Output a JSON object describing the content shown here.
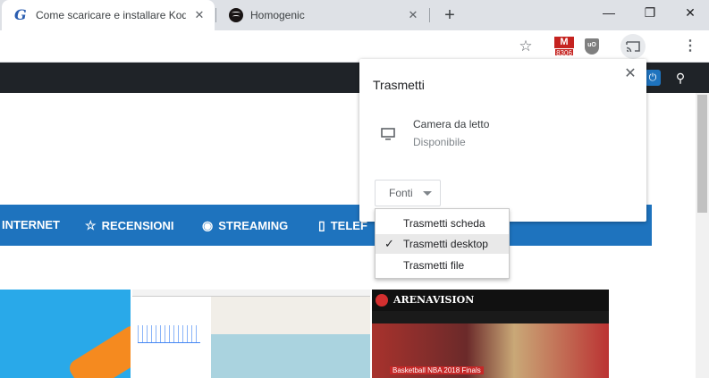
{
  "tabs": [
    {
      "title": "Come scaricare e installare Kodi su",
      "favicon": "g-italic-icon",
      "active": true
    },
    {
      "title": "Homogenic",
      "favicon": "spotify-icon",
      "active": false
    }
  ],
  "new_tab": "+",
  "window": {
    "minimize": "—",
    "restore": "❐",
    "close": "✕"
  },
  "toolbar": {
    "bookmark": "☆",
    "ext_mega_label": "M",
    "ext_mega_badge": "8306",
    "ext_ublock": "uO",
    "menu": "⋮"
  },
  "site": {
    "nav": [
      {
        "label": "INTERNET",
        "icon": ""
      },
      {
        "label": "RECENSIONI",
        "icon": "☆"
      },
      {
        "label": "STREAMING",
        "icon": "◉"
      },
      {
        "label": "TELEF",
        "icon": "▯"
      }
    ],
    "arenavision_logo": "ARENAVISION",
    "thumb_caption": "Basketball NBA 2018 Finals"
  },
  "cast": {
    "title": "Trasmetti",
    "close": "✕",
    "sink_name": "Camera da letto",
    "sink_status": "Disponibile",
    "sources_label": "Fonti",
    "sources": [
      {
        "label": "Trasmetti scheda",
        "selected": false
      },
      {
        "label": "Trasmetti desktop",
        "selected": true
      },
      {
        "label": "Trasmetti file",
        "selected": false
      }
    ],
    "check": "✓"
  },
  "colors": {
    "accent": "#1e73be",
    "topbar": "#1f2328",
    "tabstrip": "#dee1e6"
  }
}
